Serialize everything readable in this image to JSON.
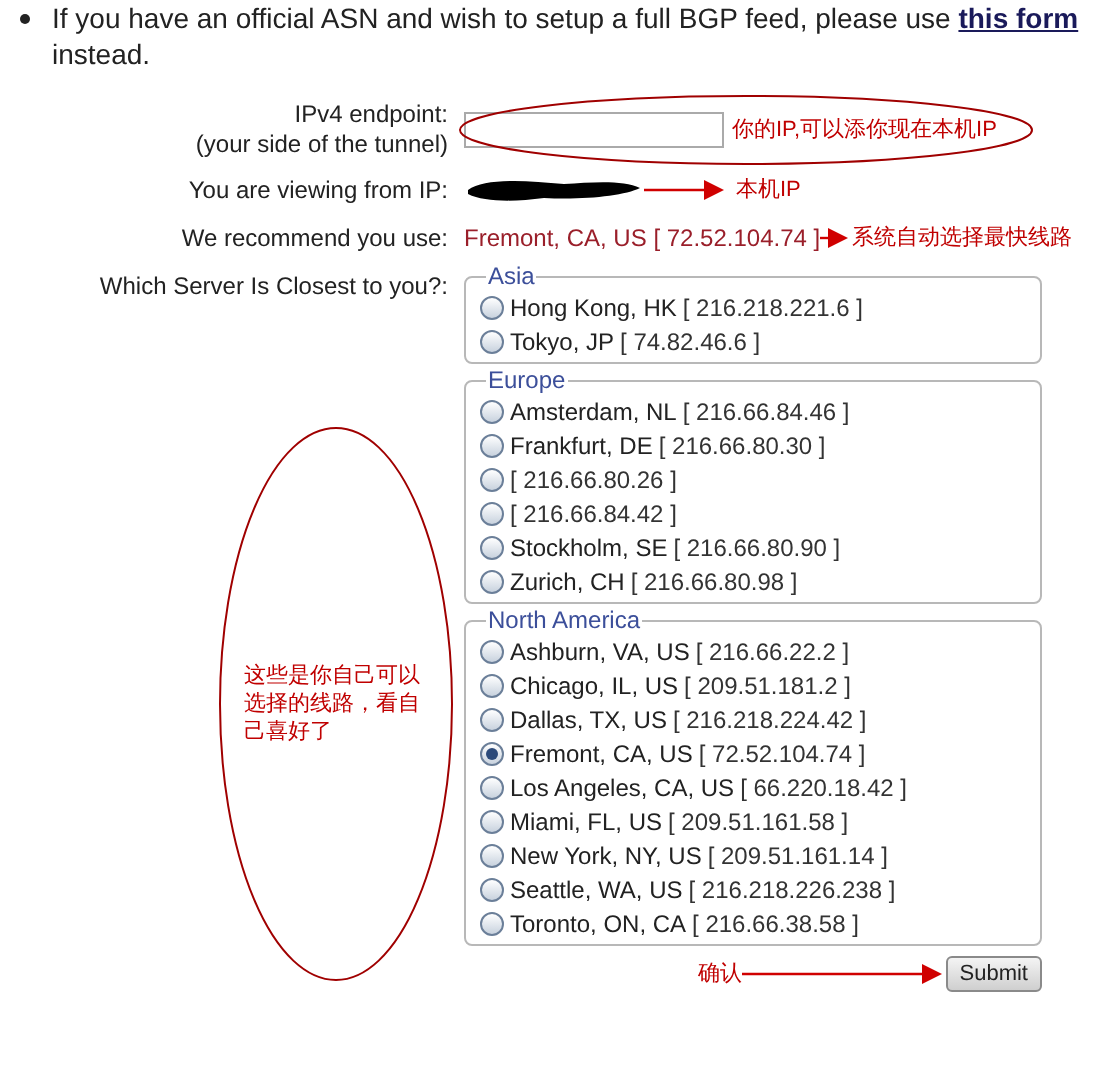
{
  "intro": {
    "text": "If you have an official ASN and wish to setup a full BGP feed, please use",
    "link": "this form",
    "after": "instead."
  },
  "form": {
    "endpoint_label": "IPv4 endpoint:",
    "endpoint_sublabel": "(your side of the tunnel)",
    "endpoint_note": "你的IP,可以添你现在本机IP",
    "viewing_label": "You are viewing from IP:",
    "viewing_note": "本机IP",
    "recommend_label": "We recommend you use:",
    "recommend_value": "Fremont, CA, US [ 72.52.104.74 ]",
    "recommend_note": "系统自动选择最快线路",
    "server_label": "Which Server Is Closest to you?:",
    "server_note": "这些是你自己可以选择的线路，看自己喜好了"
  },
  "regions": [
    {
      "name": "Asia",
      "servers": [
        {
          "location": "Hong Kong, HK",
          "ip": "[ 216.218.221.6 ]",
          "selected": false
        },
        {
          "location": "Tokyo, JP",
          "ip": "[ 74.82.46.6 ]",
          "selected": false
        }
      ]
    },
    {
      "name": "Europe",
      "servers": [
        {
          "location": "Amsterdam, NL",
          "ip": "[ 216.66.84.46 ]",
          "selected": false
        },
        {
          "location": "Frankfurt, DE",
          "ip": "[ 216.66.80.30 ]",
          "selected": false
        },
        {
          "ip": "[ 216.66.80.26 ]",
          "selected": false
        },
        {
          "ip": "[ 216.66.84.42 ]",
          "selected": false
        },
        {
          "location": "Stockholm, SE",
          "ip": "[ 216.66.80.90 ]",
          "selected": false
        },
        {
          "location": "Zurich, CH",
          "ip": "[ 216.66.80.98 ]",
          "selected": false
        }
      ]
    },
    {
      "name": "North America",
      "servers": [
        {
          "location": "Ashburn, VA, US",
          "ip": "[ 216.66.22.2 ]",
          "selected": false
        },
        {
          "location": "Chicago, IL, US",
          "ip": "[ 209.51.181.2 ]",
          "selected": false
        },
        {
          "location": "Dallas, TX, US",
          "ip": "[ 216.218.224.42 ]",
          "selected": false
        },
        {
          "location": "Fremont, CA, US",
          "ip": "[ 72.52.104.74 ]",
          "selected": true
        },
        {
          "location": "Los Angeles, CA, US",
          "ip": "[ 66.220.18.42 ]",
          "selected": false
        },
        {
          "location": "Miami, FL, US",
          "ip": "[ 209.51.161.58 ]",
          "selected": false
        },
        {
          "location": "New York, NY, US",
          "ip": "[ 209.51.161.14 ]",
          "selected": false
        },
        {
          "location": "Seattle, WA, US",
          "ip": "[ 216.218.226.238 ]",
          "selected": false
        },
        {
          "location": "Toronto, ON, CA",
          "ip": "[ 216.66.38.58 ]",
          "selected": false
        }
      ]
    }
  ],
  "submit": {
    "label": "Submit",
    "note": "确认"
  }
}
